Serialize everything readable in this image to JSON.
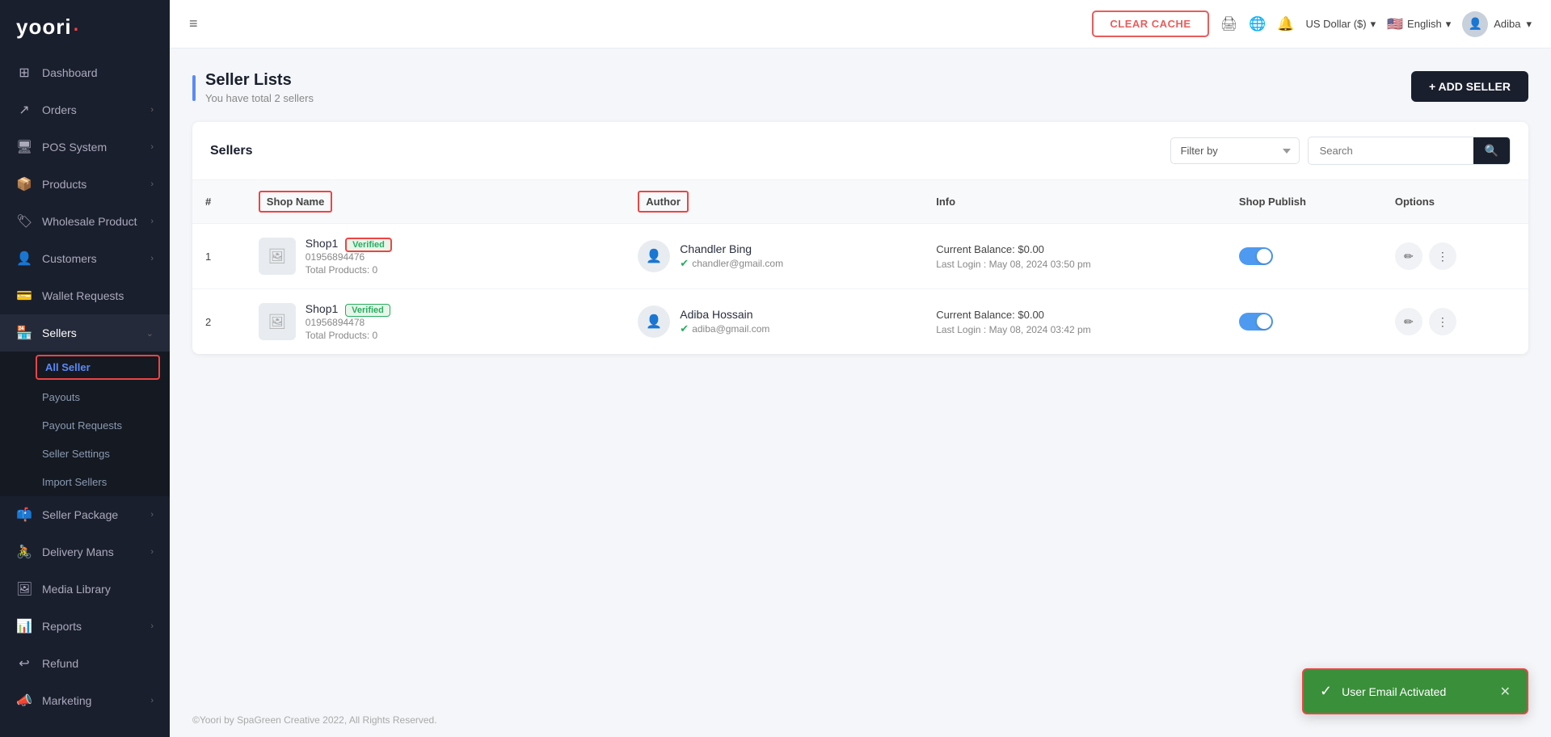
{
  "brand": {
    "name": "yoori",
    "dot": "·"
  },
  "sidebar": {
    "items": [
      {
        "id": "dashboard",
        "icon": "⊞",
        "label": "Dashboard",
        "hasArrow": false
      },
      {
        "id": "orders",
        "icon": "↗",
        "label": "Orders",
        "hasArrow": true
      },
      {
        "id": "pos",
        "icon": "🖥",
        "label": "POS System",
        "hasArrow": true
      },
      {
        "id": "products",
        "icon": "📦",
        "label": "Products",
        "hasArrow": true
      },
      {
        "id": "wholesale",
        "icon": "🏷",
        "label": "Wholesale Product",
        "hasArrow": true
      },
      {
        "id": "customers",
        "icon": "👤",
        "label": "Customers",
        "hasArrow": true
      },
      {
        "id": "wallet",
        "icon": "💳",
        "label": "Wallet Requests",
        "hasArrow": false
      },
      {
        "id": "sellers",
        "icon": "🏪",
        "label": "Sellers",
        "hasArrow": true,
        "active": true
      },
      {
        "id": "seller-package",
        "icon": "📫",
        "label": "Seller Package",
        "hasArrow": true
      },
      {
        "id": "delivery",
        "icon": "🚴",
        "label": "Delivery Mans",
        "hasArrow": true
      },
      {
        "id": "media",
        "icon": "🖼",
        "label": "Media Library",
        "hasArrow": false
      },
      {
        "id": "reports",
        "icon": "📊",
        "label": "Reports",
        "hasArrow": true
      },
      {
        "id": "refund",
        "icon": "↩",
        "label": "Refund",
        "hasArrow": false
      },
      {
        "id": "marketing",
        "icon": "📣",
        "label": "Marketing",
        "hasArrow": true
      }
    ],
    "sellers_submenu": [
      {
        "id": "all-seller",
        "label": "All Seller",
        "active": true
      },
      {
        "id": "payouts",
        "label": "Payouts"
      },
      {
        "id": "payout-requests",
        "label": "Payout Requests"
      },
      {
        "id": "seller-settings",
        "label": "Seller Settings"
      },
      {
        "id": "import-sellers",
        "label": "Import Sellers"
      }
    ]
  },
  "topbar": {
    "hamburger": "≡",
    "clear_cache": "CLEAR CACHE",
    "currency": "US Dollar ($)",
    "language": "English",
    "user": "Adiba"
  },
  "page": {
    "title": "Seller Lists",
    "subtitle": "You have total 2 sellers",
    "add_button": "+ ADD SELLER"
  },
  "table": {
    "title": "Sellers",
    "filter_placeholder": "Filter by",
    "search_placeholder": "Search",
    "columns": [
      "#",
      "Shop Name",
      "Author",
      "Info",
      "Shop Publish",
      "Options"
    ],
    "rows": [
      {
        "num": "1",
        "shop_name": "Shop1",
        "verified": "Verified",
        "phone": "01956894476",
        "products": "Total Products: 0",
        "author_name": "Chandler Bing",
        "author_email": "chandler@gmail.com",
        "balance": "Current Balance: $0.00",
        "last_login": "Last Login : May 08, 2024 03:50 pm",
        "published": true
      },
      {
        "num": "2",
        "shop_name": "Shop1",
        "verified": "Verified",
        "phone": "01956894478",
        "products": "Total Products: 0",
        "author_name": "Adiba Hossain",
        "author_email": "adiba@gmail.com",
        "balance": "Current Balance: $0.00",
        "last_login": "Last Login : May 08, 2024 03:42 pm",
        "published": true
      }
    ]
  },
  "footer": {
    "text": "©Yoori by SpaGreen Creative 2022, All Rights Reserved."
  },
  "toast": {
    "message": "User Email Activated",
    "icon": "✓"
  }
}
